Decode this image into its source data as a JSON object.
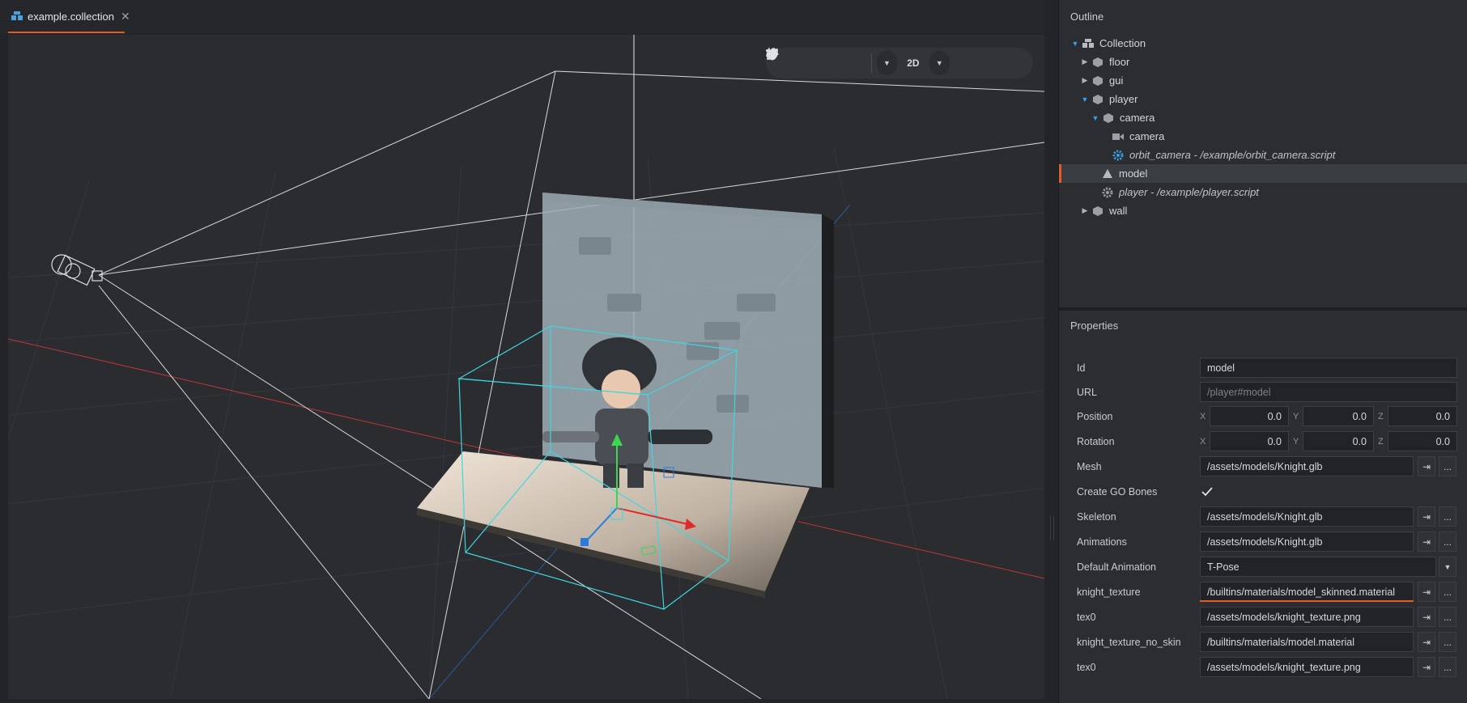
{
  "tab": {
    "label": "example.collection",
    "close": "✕"
  },
  "toolbar": {
    "mode_2d": "2D"
  },
  "outline": {
    "title": "Outline",
    "items": [
      {
        "label": "Collection"
      },
      {
        "label": "floor"
      },
      {
        "label": "gui"
      },
      {
        "label": "player"
      },
      {
        "label": "camera"
      },
      {
        "label": "camera"
      },
      {
        "label": "orbit_camera - /example/orbit_camera.script"
      },
      {
        "label": "model"
      },
      {
        "label": "player - /example/player.script"
      },
      {
        "label": "wall"
      }
    ]
  },
  "properties": {
    "title": "Properties",
    "id": {
      "label": "Id",
      "value": "model"
    },
    "url": {
      "label": "URL",
      "placeholder": "/player#model"
    },
    "position": {
      "label": "Position",
      "x": "0.0",
      "y": "0.0",
      "z": "0.0"
    },
    "rotation": {
      "label": "Rotation",
      "x": "0.0",
      "y": "0.0",
      "z": "0.0"
    },
    "axes": {
      "x": "X",
      "y": "Y",
      "z": "Z"
    },
    "mesh": {
      "label": "Mesh",
      "value": "/assets/models/Knight.glb"
    },
    "create_go_bones": {
      "label": "Create GO Bones",
      "checked": true
    },
    "skeleton": {
      "label": "Skeleton",
      "value": "/assets/models/Knight.glb"
    },
    "animations": {
      "label": "Animations",
      "value": "/assets/models/Knight.glb"
    },
    "default_animation": {
      "label": "Default Animation",
      "value": "T-Pose"
    },
    "knight_texture": {
      "label": "knight_texture",
      "value": "/builtins/materials/model_skinned.material"
    },
    "tex0_a": {
      "label": "tex0",
      "value": "/assets/models/knight_texture.png"
    },
    "knight_texture_no_skin": {
      "label": "knight_texture_no_skin",
      "value": "/builtins/materials/model.material"
    },
    "tex0_b": {
      "label": "tex0",
      "value": "/assets/models/knight_texture.png"
    },
    "ellipsis": "..."
  },
  "colors": {
    "accent": "#e55a2b",
    "selection_cyan": "#3fd6e0",
    "tree_arrow": "#3aa0e8"
  }
}
